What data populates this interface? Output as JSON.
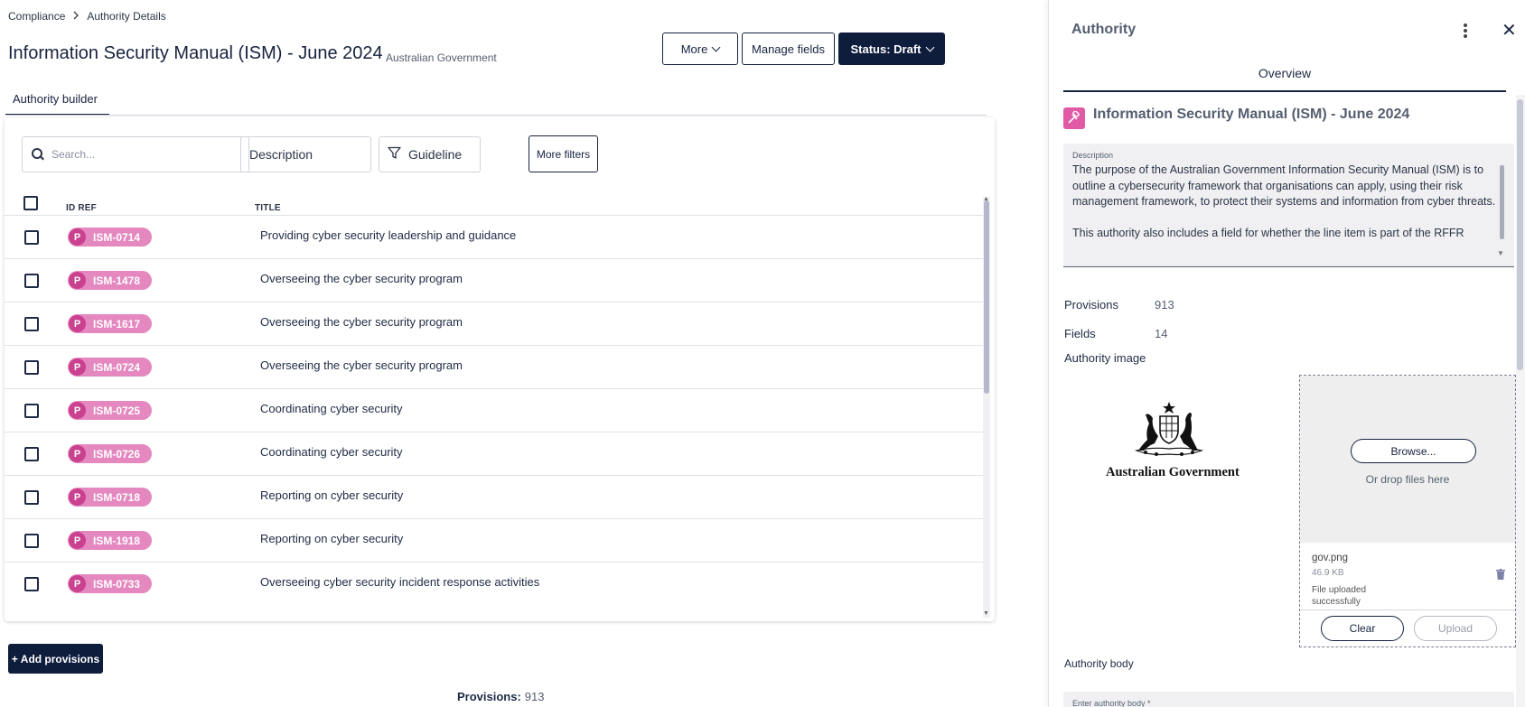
{
  "breadcrumb": {
    "root": "Compliance",
    "current": "Authority Details"
  },
  "page": {
    "title": "Information Security Manual (ISM) - June 2024",
    "subtitle": "Australian Government"
  },
  "toolbar": {
    "more_label": "More",
    "manage_fields_label": "Manage fields",
    "status_label": "Status: Draft"
  },
  "tabs": {
    "active": "Authority builder"
  },
  "filters": {
    "search_placeholder": "Search...",
    "description_label": "Description",
    "guideline_label": "Guideline",
    "more_filters_label": "More filters"
  },
  "table": {
    "columns": {
      "id_ref": "ID REF",
      "title": "TITLE"
    },
    "badge_letter": "P",
    "rows": [
      {
        "id": "ISM-0714",
        "title": "Providing cyber security leadership and guidance"
      },
      {
        "id": "ISM-1478",
        "title": "Overseeing the cyber security program"
      },
      {
        "id": "ISM-1617",
        "title": "Overseeing the cyber security program"
      },
      {
        "id": "ISM-0724",
        "title": "Overseeing the cyber security program"
      },
      {
        "id": "ISM-0725",
        "title": "Coordinating cyber security"
      },
      {
        "id": "ISM-0726",
        "title": "Coordinating cyber security"
      },
      {
        "id": "ISM-0718",
        "title": "Reporting on cyber security"
      },
      {
        "id": "ISM-1918",
        "title": "Reporting on cyber security"
      },
      {
        "id": "ISM-0733",
        "title": "Overseeing cyber security incident response activities"
      }
    ]
  },
  "actions": {
    "add_provisions_label": "+ Add provisions"
  },
  "footer": {
    "provisions_label": "Provisions:",
    "provisions_value": "913"
  },
  "panel": {
    "title": "Authority",
    "tab": "Overview",
    "authority_name": "Information Security Manual (ISM) - June 2024",
    "description_label": "Description",
    "description_p1": "The purpose of the Australian Government Information Security Manual (ISM) is to outline a cybersecurity framework that organisations can apply, using their risk management framework, to protect their systems and information from cyber threats.",
    "description_p2": "This authority also includes a field for whether the line item is part of the RFFR",
    "provisions_label": "Provisions",
    "provisions_value": "913",
    "fields_label": "Fields",
    "fields_value": "14",
    "image_label": "Authority image",
    "logo_text": "Australian Government",
    "upload": {
      "browse_label": "Browse...",
      "drop_text": "Or drop files here",
      "file_name": "gov.png",
      "file_size": "46.9 KB",
      "file_status": "File uploaded successfully",
      "clear_label": "Clear",
      "upload_label": "Upload"
    },
    "body_label": "Authority body",
    "body_field_label": "Enter authority body *"
  },
  "colors": {
    "navy": "#0f1d3d",
    "badge": "#e488bf",
    "badge_dot": "#c9418f",
    "authority_icon": "#e05aa6"
  },
  "icons": [
    "chevron-right-icon",
    "chevron-down-icon",
    "search-icon",
    "filter-icon",
    "kebab-icon",
    "close-icon",
    "gavel-icon",
    "trash-icon"
  ]
}
